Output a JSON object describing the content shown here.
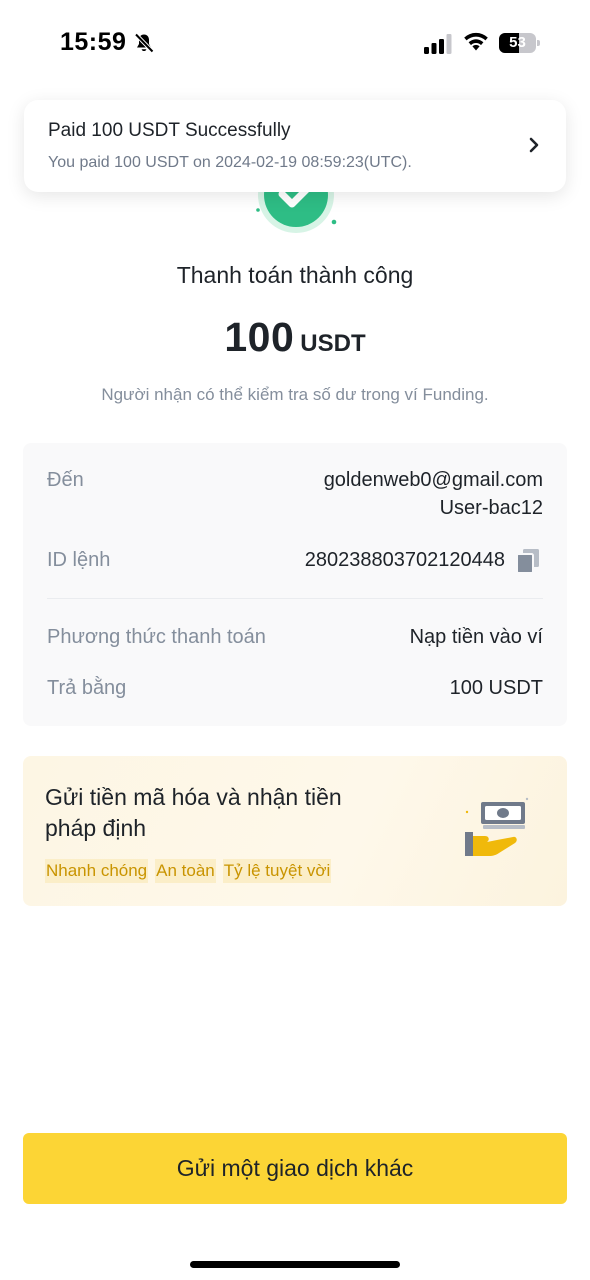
{
  "status_bar": {
    "time": "15:59",
    "battery_level": "53",
    "battery_fill_percent": 53
  },
  "icons": {
    "bell_off": "bell-slash-icon",
    "signal": "cellular-signal-icon",
    "wifi": "wifi-icon",
    "success": "check-circle-icon",
    "chevron": "chevron-right-icon",
    "copy": "copy-icon",
    "cash": "cash-hand-icon"
  },
  "colors": {
    "accent": "#FCD535",
    "success": "#2EBD85",
    "tag_text": "#C99400"
  },
  "toast": {
    "title": "Paid 100 USDT Successfully",
    "subtitle": "You paid 100 USDT on 2024-02-19 08:59:23(UTC)."
  },
  "result": {
    "title": "Thanh toán thành công",
    "amount": "100",
    "unit": "USDT",
    "note": "Người nhận có thể kiểm tra số dư trong ví Funding."
  },
  "details": {
    "to_label": "Đến",
    "to_email": "goldenweb0@gmail.com",
    "to_user": "User-bac12",
    "order_id_label": "ID lệnh",
    "order_id": "280238803702120448",
    "method_label": "Phương thức thanh toán",
    "method_value": "Nạp tiền vào ví",
    "paid_with_label": "Trả bằng",
    "paid_with_value": "100 USDT"
  },
  "promo": {
    "title": "Gửi tiền mã hóa và nhận tiền pháp định",
    "tags": [
      "Nhanh chóng",
      "An toàn",
      "Tỷ lệ tuyệt vời"
    ]
  },
  "action": {
    "button_label": "Gửi một giao dịch khác"
  }
}
